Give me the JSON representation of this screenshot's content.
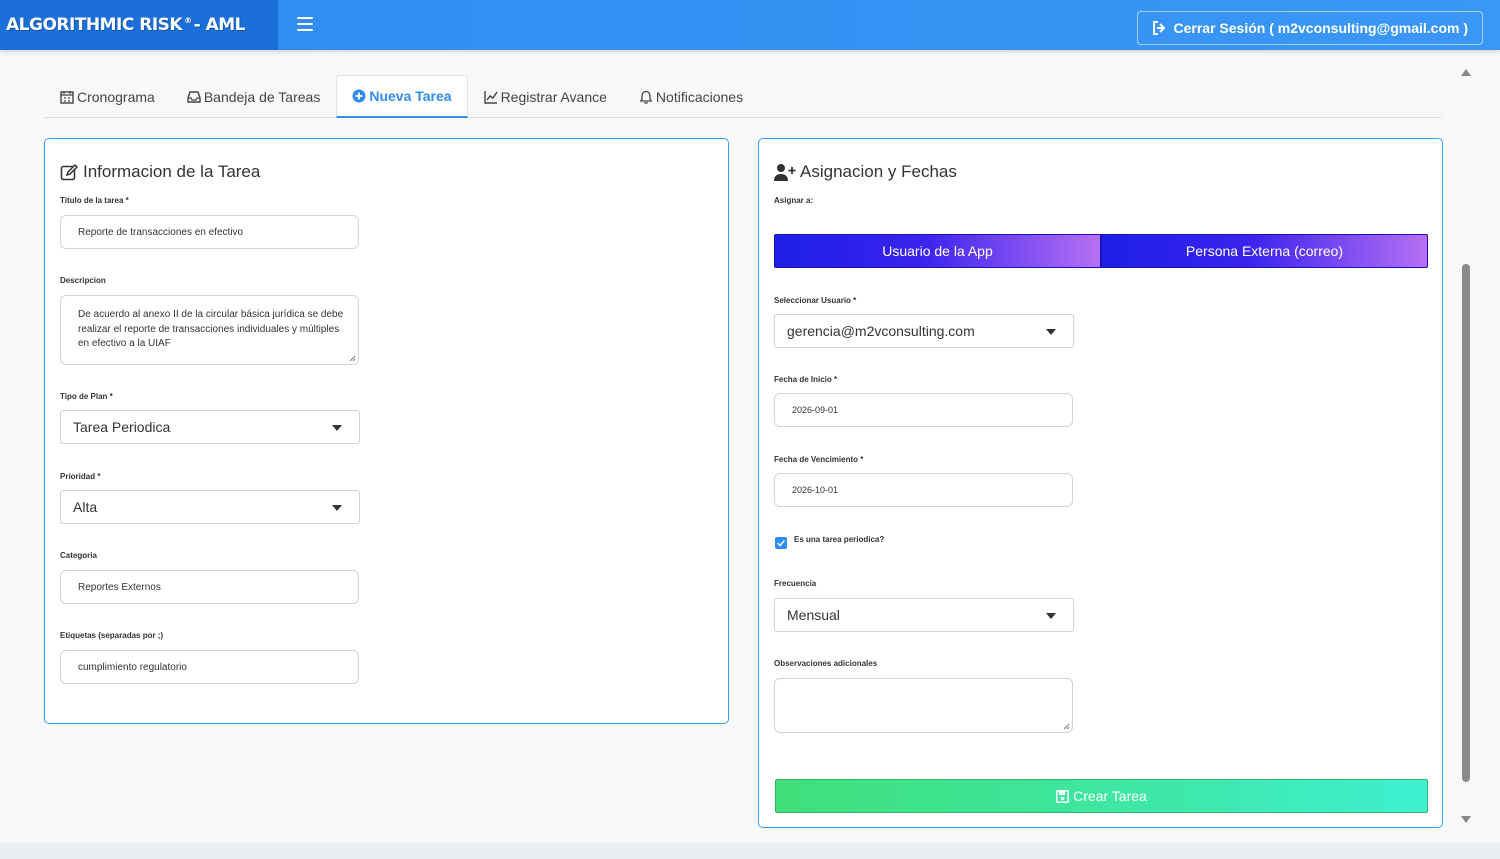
{
  "app": {
    "title_main": "ALGORITHMIC RISK",
    "title_reg": "®",
    "title_suffix": "- AML"
  },
  "header": {
    "logout_label": "Cerrar Sesión ( m2vconsulting@gmail.com )"
  },
  "tabs": [
    {
      "label": "Cronograma",
      "icon": "calendar-icon"
    },
    {
      "label": "Bandeja de Tareas",
      "icon": "inbox-icon"
    },
    {
      "label": "Nueva Tarea",
      "icon": "plus-circle-icon",
      "active": true
    },
    {
      "label": "Registrar Avance",
      "icon": "line-chart-icon"
    },
    {
      "label": "Notificaciones",
      "icon": "bell-icon"
    }
  ],
  "task_info": {
    "title": "Informacion de la Tarea",
    "task_title_label": "Titulo de la tarea *",
    "task_title_value": "Reporte de transacciones en efectivo",
    "description_label": "Descripcion",
    "description_value": "De acuerdo al anexo II de la circular básica jurídica se debe realizar el reporte de transacciones individuales y múltiples en efectivo a la UIAF",
    "plan_type_label": "Tipo de Plan *",
    "plan_type_value": "Tarea Periodica",
    "priority_label": "Prioridad *",
    "priority_value": "Alta",
    "category_label": "Categoria",
    "category_value": "Reportes Externos",
    "tags_label": "Etiquetas (separadas por ;)",
    "tags_value": "cumplimiento regulatorio"
  },
  "assignment": {
    "title": "Asignacion y Fechas",
    "assign_to_label": "Asignar a:",
    "app_user_button": "Usuario de la App",
    "external_person_button": "Persona Externa (correo)",
    "select_user_label": "Seleccionar Usuario *",
    "select_user_value": "gerencia@m2vconsulting.com",
    "start_date_label": "Fecha de Inicio *",
    "start_date_value": "2026-09-01",
    "due_date_label": "Fecha de Vencimiento *",
    "due_date_value": "2026-10-01",
    "periodic_checkbox_label": "Es una tarea periodica?",
    "periodic_checked": true,
    "frequency_label": "Frecuencia",
    "frequency_value": "Mensual",
    "notes_label": "Observaciones adicionales",
    "notes_value": "",
    "create_button": "Crear Tarea"
  },
  "colors": {
    "header_blue": "#2f8cf0",
    "card_border": "#3d9bf3",
    "assign_gradient_start": "#1d1fe8",
    "assign_gradient_end": "#b670f4",
    "create_gradient_start": "#3fe07a",
    "create_gradient_end": "#3ef0d1"
  }
}
